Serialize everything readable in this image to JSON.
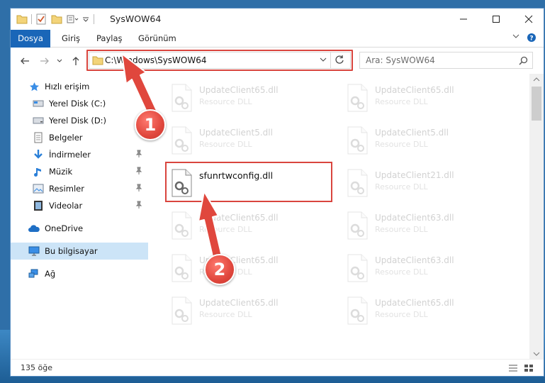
{
  "window": {
    "title": "SysWOW64"
  },
  "ribbon": {
    "tabs": [
      "Dosya",
      "Giriş",
      "Paylaş",
      "Görünüm"
    ]
  },
  "nav": {
    "address": "C:\\Windows\\SysWOW64",
    "search_placeholder": "Ara: SysWOW64"
  },
  "sidebar": {
    "items": [
      {
        "label": "Hızlı erişim",
        "icon": "star-icon"
      },
      {
        "label": "Yerel Disk (C:)",
        "icon": "drive-icon"
      },
      {
        "label": "Yerel Disk (D:)",
        "icon": "drive-icon"
      },
      {
        "label": "Belgeler",
        "icon": "documents-icon"
      },
      {
        "label": "İndirmeler",
        "icon": "download-icon"
      },
      {
        "label": "Müzik",
        "icon": "music-icon"
      },
      {
        "label": "Resimler",
        "icon": "pictures-icon"
      },
      {
        "label": "Videolar",
        "icon": "video-icon"
      },
      {
        "label": "OneDrive",
        "icon": "cloud-icon"
      },
      {
        "label": "Bu bilgisayar",
        "icon": "computer-icon"
      },
      {
        "label": "Ağ",
        "icon": "network-icon"
      }
    ]
  },
  "files": {
    "left": [
      {
        "name": "UpdateClient65.dll",
        "type": "Resource DLL"
      },
      {
        "name": "UpdateClient5.dll",
        "type": "Resource DLL"
      },
      {
        "name": "sfunrtwconfig.dll",
        "type": ""
      },
      {
        "name": "UpdateClient65.dll",
        "type": "Resource DLL"
      },
      {
        "name": "UpdateClient65.dll",
        "type": "Resource DLL"
      },
      {
        "name": "UpdateClient65.dll",
        "type": "Resource DLL"
      }
    ],
    "right": [
      {
        "name": "UpdateClient65.dll",
        "type": "Resource DLL"
      },
      {
        "name": "UpdateClient5.dll",
        "type": "Resource DLL"
      },
      {
        "name": "UpdateClient21.dll",
        "type": "Resource DLL"
      },
      {
        "name": "UpdateClient63.dll",
        "type": "Resource DLL"
      },
      {
        "name": "UpdateClient63.dll",
        "type": "Resource DLL"
      },
      {
        "name": "UpdateClient65.dll",
        "type": "Resource DLL"
      }
    ]
  },
  "status": {
    "count": "135 öğe"
  },
  "callouts": [
    "1",
    "2"
  ],
  "colors": {
    "accent": "#1a66b8",
    "highlight": "#d9453e",
    "selected": "#cce4f7"
  }
}
